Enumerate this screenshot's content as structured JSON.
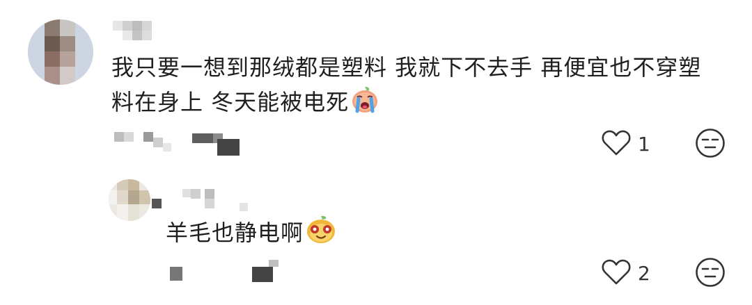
{
  "comments": [
    {
      "text_line1": "我只要一想到那绒都是塑料 我就下不去手 再便宜也不穿塑",
      "text_line2": "料在身上 冬天能被电死",
      "emoji": "crying-face-emoji",
      "like_count": "1",
      "reply": {
        "text": "羊毛也静电啊",
        "emoji": "smug-face-emoji",
        "like_count": "2"
      }
    }
  ],
  "icons": {
    "like": "heart-outline-icon",
    "dislike": "meh-face-icon"
  },
  "colors": {
    "text": "#1f1f1f",
    "icon": "#333333",
    "pixelated_gray": "#9a9a9a"
  }
}
